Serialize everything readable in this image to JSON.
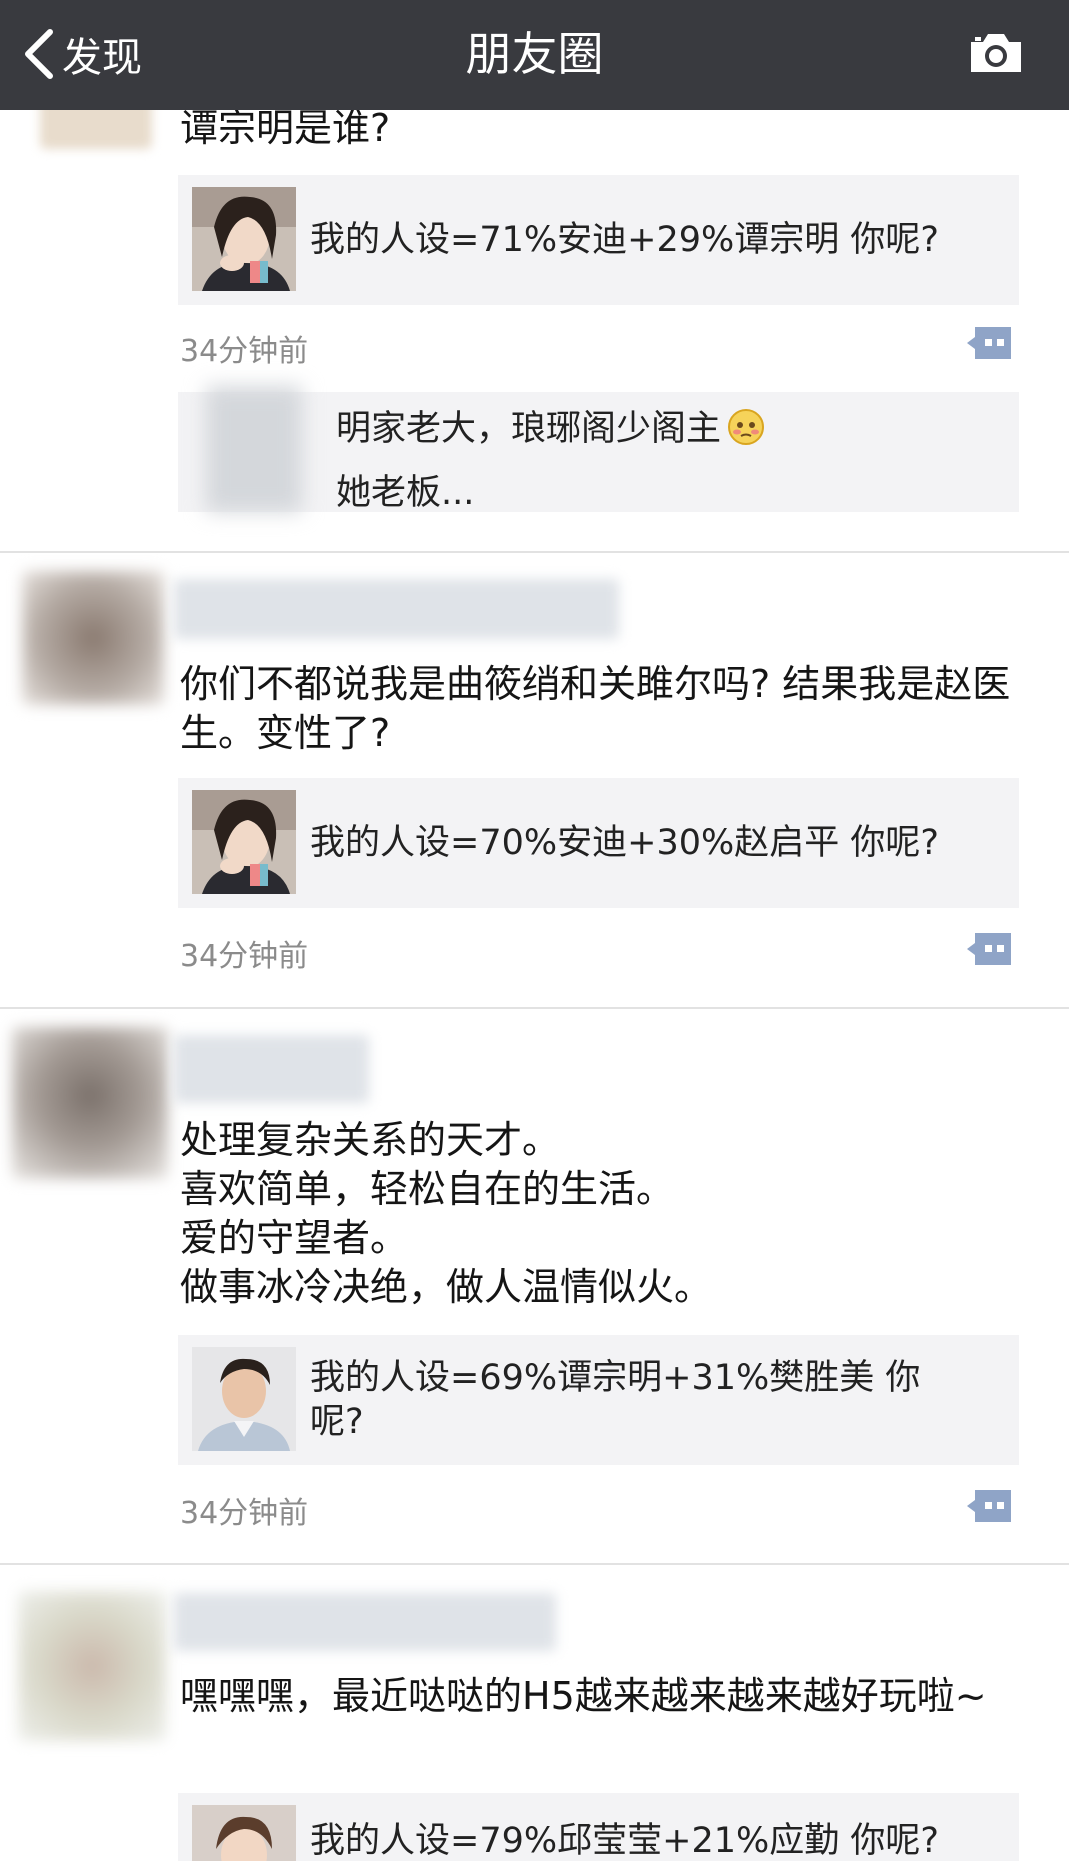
{
  "header": {
    "back_label": "发现",
    "title": "朋友圈"
  },
  "posts": [
    {
      "text": "谭宗明是谁?",
      "card_caption": "我的人设=71%安迪+29%谭宗明 你呢?",
      "card_thumb": "woman-portrait",
      "time": "34分钟前",
      "comment": {
        "line1": "明家老大，琅琊阁少阁主",
        "line2": "她老板...",
        "emoji": "shy-emoji"
      }
    },
    {
      "text": "你们不都说我是曲筱绡和关雎尔吗? 结果我是赵医生。变性了?",
      "card_caption": "我的人设=70%安迪+30%赵启平 你呢?",
      "card_thumb": "woman-portrait",
      "time": "34分钟前"
    },
    {
      "text": "处理复杂关系的天才。\n喜欢简单，轻松自在的生活。\n爱的守望者。\n做事冰冷决绝，做人温情似火。",
      "card_caption": "我的人设=69%谭宗明+31%樊胜美 你呢?",
      "card_thumb": "man-portrait",
      "time": "34分钟前"
    },
    {
      "text": "嘿嘿嘿，最近哒哒的H5越来越来越来越好玩啦~",
      "card_caption": "我的人设=79%邱莹莹+21%应勤 你呢?",
      "card_thumb": "woman-portrait"
    }
  ],
  "colors": {
    "topbar": "#393a3f",
    "card_bg": "#f3f3f5",
    "link_blue": "#576b95",
    "time_gray": "#8b8b8b"
  }
}
